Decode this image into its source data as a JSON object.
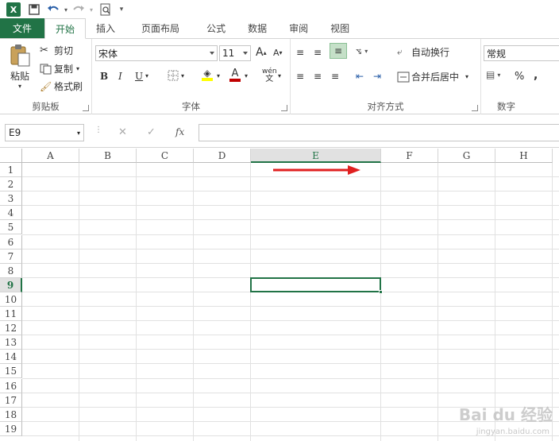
{
  "qat": {
    "app_icon": "excel-logo",
    "app_icon_text": "X",
    "save_icon": "save-icon",
    "undo_icon": "undo-icon",
    "redo_icon": "redo-icon",
    "preview_icon": "print-preview-icon",
    "customize_icon": "customize-qat-icon"
  },
  "tabs": [
    {
      "label": "文件"
    },
    {
      "label": "开始"
    },
    {
      "label": "插入"
    },
    {
      "label": "页面布局"
    },
    {
      "label": "公式"
    },
    {
      "label": "数据"
    },
    {
      "label": "审阅"
    },
    {
      "label": "视图"
    }
  ],
  "ribbon": {
    "clipboard": {
      "label": "剪贴板",
      "paste": "粘贴",
      "cut": "剪切",
      "copy": "复制",
      "format_painter": "格式刷"
    },
    "font": {
      "label": "字体",
      "font_name": "宋体",
      "font_size": "11",
      "bold": "B",
      "italic": "I",
      "underline": "U",
      "grow": "A",
      "shrink": "A",
      "font_color_letter": "A",
      "phonetic": "wén",
      "font_color": "#c00000",
      "highlight_color": "#ffff00"
    },
    "alignment": {
      "label": "对齐方式",
      "wrap_text": "自动换行",
      "merge_center": "合并后居中"
    },
    "number": {
      "label": "数字",
      "format": "常规",
      "percent": "%",
      "comma": ","
    }
  },
  "formula_bar": {
    "name_box": "E9",
    "cancel": "✕",
    "enter": "✓",
    "fx": "fx",
    "value": ""
  },
  "sheet": {
    "columns": [
      "A",
      "B",
      "C",
      "D",
      "E",
      "F",
      "G",
      "H"
    ],
    "rows": [
      "1",
      "2",
      "3",
      "4",
      "5",
      "6",
      "7",
      "8",
      "9",
      "10",
      "11",
      "12",
      "13",
      "14",
      "15",
      "16",
      "17",
      "18",
      "19"
    ],
    "selected_column": "E",
    "selected_row": "9",
    "accent": "#217346",
    "arrow_color": "#e02020"
  },
  "watermark": {
    "logo": "Bai du 经验",
    "url": "jingyan.baidu.com"
  }
}
